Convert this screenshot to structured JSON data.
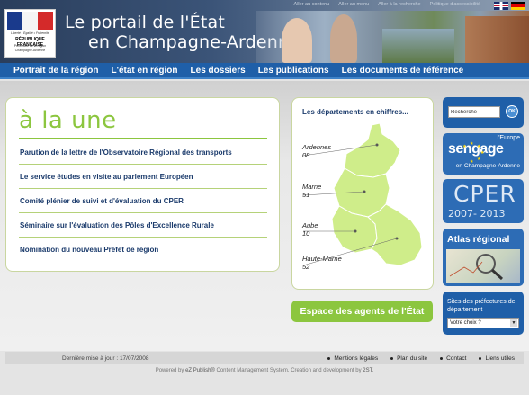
{
  "header": {
    "logo_motto": "Liberté • Égalité • Fraternité",
    "logo_republic": "RÉPUBLIQUE FRANÇAISE",
    "logo_sub": "Préfecture de la région Champagne-Ardenne",
    "title_line1": "Le portail de l'État",
    "title_line2": "en Champagne-Ardenne",
    "quicklinks": [
      "Aller au contenu",
      "Aller au menu",
      "Aller à la recherche",
      "Politique d'accessibilité"
    ]
  },
  "nav": {
    "items": [
      "Portrait de la région",
      "L'état en région",
      "Les dossiers",
      "Les publications",
      "Les documents de référence"
    ]
  },
  "une": {
    "title": "à la une",
    "items": [
      "Parution de la lettre de l'Observatoire Régional des transports",
      "Le service études en visite au parlement Européen",
      "Comité plénier de suivi et d'évaluation du CPER",
      "Séminaire sur l'évaluation des Pôles d'Excellence Rurale",
      "Nomination du nouveau Préfet de région"
    ]
  },
  "departements": {
    "title": "Les départements en chiffres...",
    "items": [
      {
        "name": "Ardennes",
        "code": "08"
      },
      {
        "name": "Marne",
        "code": "51"
      },
      {
        "name": "Aube",
        "code": "10"
      },
      {
        "name": "Haute-Marne",
        "code": "52"
      }
    ]
  },
  "agents_button": "Espace des agents de l'État",
  "search": {
    "placeholder": "Recherche",
    "go": "OK"
  },
  "europe": {
    "line1": "l'Europe",
    "line2": "sengage",
    "line3": "en Champagne-Ardenne"
  },
  "cper": {
    "line1": "CPER",
    "line2": "2007- 2013"
  },
  "atlas": {
    "title": "Atlas régional"
  },
  "prefectures": {
    "title": "Sites des préfectures de département",
    "selected": "Votre choix ?"
  },
  "footer": {
    "last_update": "Dernière mise à jour : 17/07/2008",
    "links": [
      "Mentions légales",
      "Plan du site",
      "Contact",
      "Liens utiles"
    ],
    "powered_1": "Powered by",
    "powered_link1": "eZ Publish®",
    "powered_2": "Content Management System. Creation and development by",
    "powered_link2": "2ST",
    "powered_3": "."
  },
  "colors": {
    "nav_blue": "#1f5fa8",
    "accent_green": "#8cc63f",
    "map_green": "#cfed8a",
    "text_navy": "#1a3a6b"
  }
}
